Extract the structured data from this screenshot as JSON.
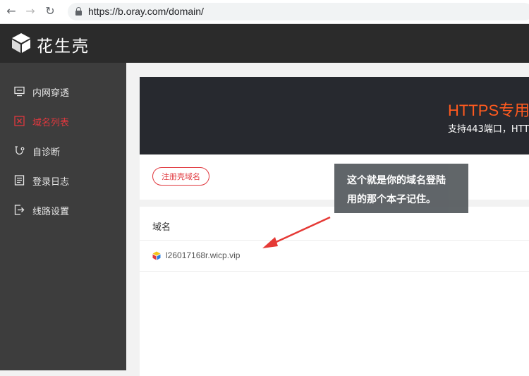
{
  "browser": {
    "url": "https://b.oray.com/domain/"
  },
  "app": {
    "logo_text": "花生壳"
  },
  "sidebar": {
    "items": [
      {
        "label": "内网穿透",
        "icon": "monitor-icon"
      },
      {
        "label": "域名列表",
        "icon": "domain-list-icon",
        "active": true
      },
      {
        "label": "自诊断",
        "icon": "diagnose-icon"
      },
      {
        "label": "登录日志",
        "icon": "log-icon"
      },
      {
        "label": "线路设置",
        "icon": "route-icon"
      }
    ]
  },
  "banner": {
    "title": "HTTPS专用",
    "subtitle": "支持443端口，HTTP"
  },
  "main": {
    "register_button": "注册壳域名",
    "column_header": "域名",
    "domains": [
      {
        "name": "l26017168r.wicp.vip"
      }
    ]
  },
  "annotation": {
    "line1": "这个就是你的域名登陆",
    "line2": "用的那个本子记住。"
  },
  "colors": {
    "accent": "#e0383e",
    "banner_title": "#ff5a1f",
    "sidebar_bg": "#3d3d3d",
    "header_bg": "#2b2b2b",
    "arrow": "#e53935"
  }
}
